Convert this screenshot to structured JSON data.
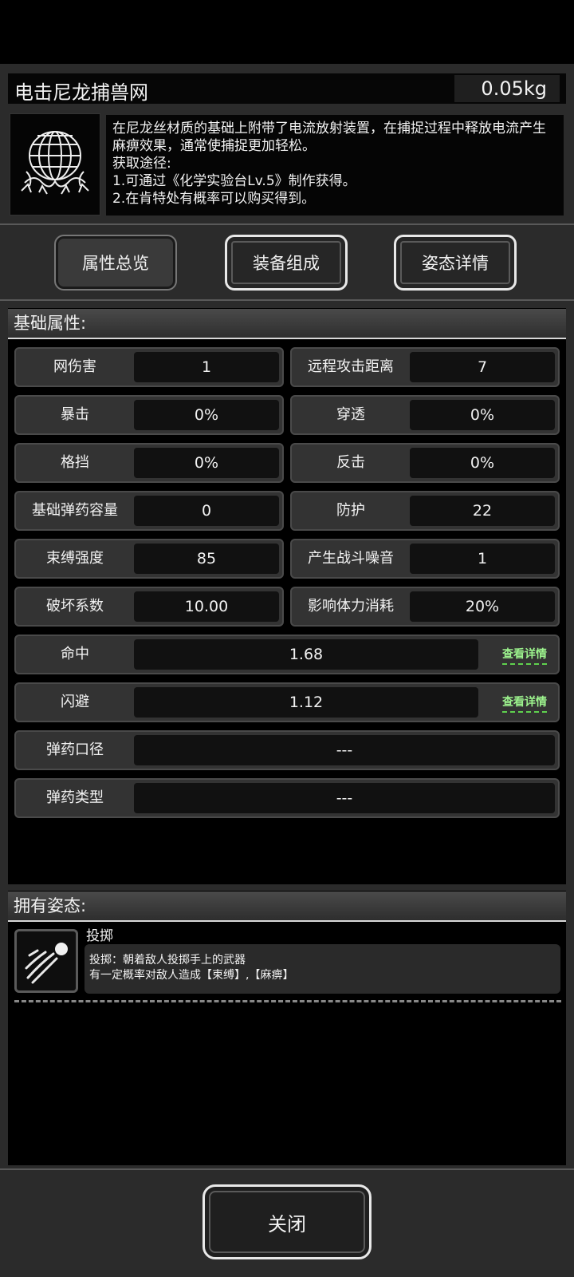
{
  "item": {
    "name": "电击尼龙捕兽网",
    "weight": "0.05kg",
    "icon": "net-icon",
    "description": "在尼龙丝材质的基础上附带了电流放射装置，在捕捉过程中释放电流产生麻痹效果，通常使捕捉更加轻松。\n获取途径:\n1.可通过《化学实验台Lv.5》制作获得。\n2.在肯特处有概率可以购买得到。"
  },
  "tabs": [
    {
      "label": "属性总览",
      "active": true
    },
    {
      "label": "装备组成",
      "active": false
    },
    {
      "label": "姿态详情",
      "active": false
    }
  ],
  "attributes": {
    "title": "基础属性:",
    "pairs": [
      {
        "label": "网伤害",
        "value": "1"
      },
      {
        "label": "远程攻击距离",
        "value": "7"
      },
      {
        "label": "暴击",
        "value": "0%"
      },
      {
        "label": "穿透",
        "value": "0%"
      },
      {
        "label": "格挡",
        "value": "0%"
      },
      {
        "label": "反击",
        "value": "0%"
      },
      {
        "label": "基础弹药容量",
        "value": "0"
      },
      {
        "label": "防护",
        "value": "22"
      },
      {
        "label": "束缚强度",
        "value": "85"
      },
      {
        "label": "产生战斗噪音",
        "value": "1"
      },
      {
        "label": "破坏系数",
        "value": "10.00"
      },
      {
        "label": "影响体力消耗",
        "value": "20%"
      }
    ],
    "wide": [
      {
        "label": "命中",
        "value": "1.68",
        "link": "查看详情"
      },
      {
        "label": "闪避",
        "value": "1.12",
        "link": "查看详情"
      },
      {
        "label": "弹药口径",
        "value": "---"
      },
      {
        "label": "弹药类型",
        "value": "---"
      }
    ]
  },
  "stances": {
    "title": "拥有姿态:",
    "items": [
      {
        "name": "投掷",
        "icon": "throw-icon",
        "description": "投掷：朝着敌人投掷手上的武器\n有一定概率对敌人造成【束缚】,【麻痹】"
      }
    ]
  },
  "close_label": "关闭",
  "colors": {
    "accent_link": "#9cf28d",
    "panel": "#2b2b2b",
    "background": "#000000"
  }
}
